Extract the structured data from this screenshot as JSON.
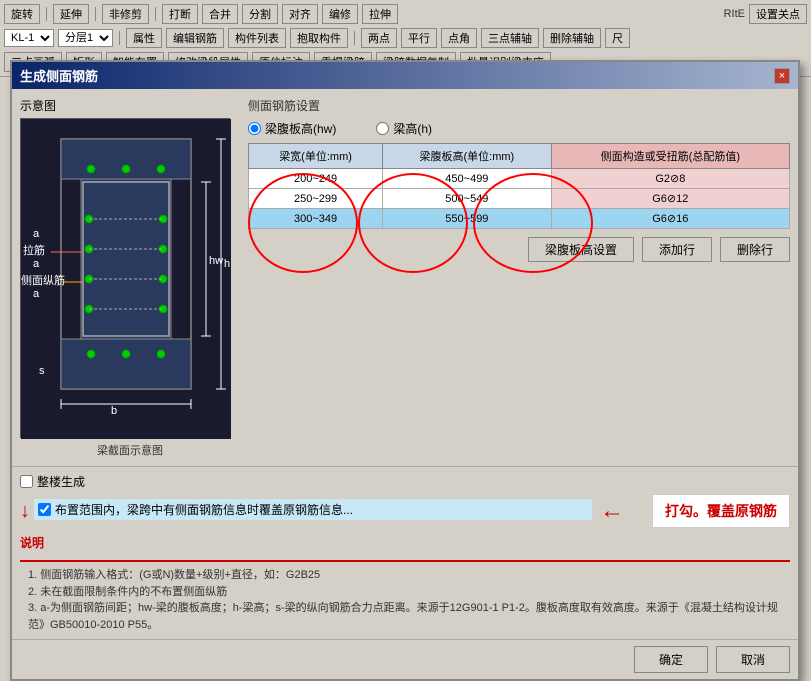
{
  "toolbar": {
    "rows": [
      {
        "items": [
          "旋转",
          "延伸",
          "非修剪",
          "打断",
          "合并",
          "分割",
          "对齐",
          "编修",
          "拉伸"
        ]
      },
      {
        "select1": "KL-1",
        "select2": "分层1",
        "items": [
          "属性",
          "编辑钢筋",
          "构件列表",
          "抱取构件",
          "两点",
          "平行",
          "点角",
          "三点辅轴",
          "删除辅轴"
        ]
      },
      {
        "items": [
          "三点画弧",
          "矩形",
          "智能布置",
          "修改梁段属性",
          "原位标注",
          "重提梁跨",
          "梁跨数据复制",
          "批量识别梁支座"
        ]
      }
    ]
  },
  "dialog": {
    "title": "生成侧面钢筋",
    "close_label": "×",
    "diagram_label": "示意图",
    "diagram_caption": "梁截面示意图",
    "settings_title": "侧面钢筋设置",
    "radio1_label": "梁腹板高(hw)",
    "radio2_label": "梁高(h)",
    "table": {
      "headers": [
        "梁宽(单位:mm)",
        "梁腹板高(单位:mm)",
        "侧面构造或受扭筋(总配筋值)"
      ],
      "rows": [
        [
          "200~249",
          "450~499",
          "G2⊘8"
        ],
        [
          "250~299",
          "500~549",
          "G6⊘12"
        ],
        [
          "300~349",
          "550~599",
          "G6⊘16"
        ]
      ]
    },
    "btn_slab_height": "梁腹板高设置",
    "btn_add": "添加行",
    "btn_delete": "删除行",
    "checkbox1_label": "整楼生成",
    "checkbox2_label": "布置范围内，梁跨中有侧面钢筋信息时覆盖原钢筋信息...",
    "arrow_text": "打勾。覆盖原钢筋",
    "notes_title": "说明",
    "notes": [
      "1. 侧面钢筋输入格式：(G或N)数量+级别+直径，如：G2B25",
      "2. 未在截面限制条件内的不布置侧面纵筋",
      "3. a-为侧面钢筋间距；hw-梁的腹板高度；h-梁高；s-梁的纵向钢筋合力点距离。来源于12G901-1 P1-2。腹板高度取有效高度。来源于《混凝土结构设计规范》GB50010-2010 P55。"
    ],
    "btn_confirm": "确定",
    "btn_cancel": "取消"
  },
  "diagram": {
    "labels": {
      "lajin": "拉筋",
      "cemian_zong": "侧面纵筋",
      "hw": "hw",
      "h": "h",
      "a": "a",
      "b": "b",
      "s": "s"
    }
  },
  "colors": {
    "title_bg_start": "#0a246a",
    "title_bg_end": "#a6b5d0",
    "highlight_col": "#e8b8b8",
    "selected_row": "#9dd4f0"
  }
}
